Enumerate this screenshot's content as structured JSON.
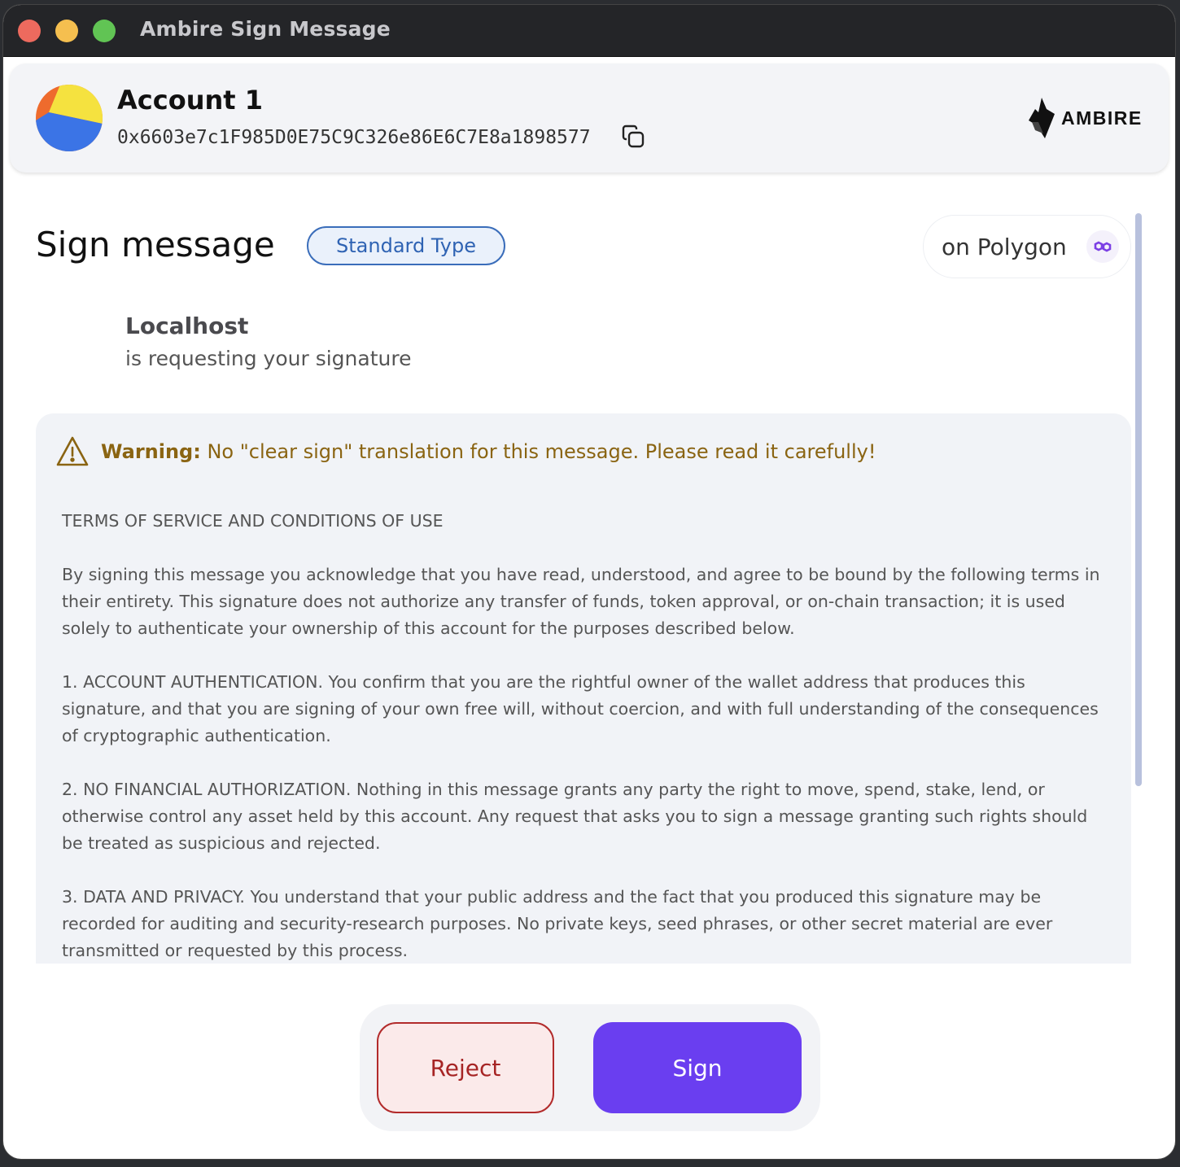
{
  "window": {
    "title": "Ambire Sign Message"
  },
  "account": {
    "name": "Account 1",
    "address": "0x6603e7c1F985D0E75C9C326e86E6C7E8a1898577"
  },
  "brand": {
    "name": "AMBIRE"
  },
  "page": {
    "title": "Sign message",
    "type_badge": "Standard Type",
    "network": "on Polygon"
  },
  "request": {
    "origin": "Localhost",
    "text": "is requesting your signature"
  },
  "warning": {
    "label": "Warning:",
    "text": " No \"clear sign\" translation for this message. Please read it carefully!"
  },
  "message": {
    "paragraphs": [
      "TERMS OF SERVICE AND CONDITIONS OF USE",
      "By signing this message you acknowledge that you have read, understood, and agree to be bound by the following terms in their entirety. This signature does not authorize any transfer of funds, token approval, or on-chain transaction; it is used solely to authenticate your ownership of this account for the purposes described below.",
      "1. ACCOUNT AUTHENTICATION. You confirm that you are the rightful owner of the wallet address that produces this signature, and that you are signing of your own free will, without coercion, and with full understanding of the consequences of cryptographic authentication.",
      "2. NO FINANCIAL AUTHORIZATION. Nothing in this message grants any party the right to move, spend, stake, lend, or otherwise control any asset held by this account. Any request that asks you to sign a message granting such rights should be treated as suspicious and rejected.",
      "3. DATA AND PRIVACY. You understand that your public address and the fact that you produced this signature may be recorded for auditing and security-research purposes. No private keys, seed phrases, or other secret material are ever transmitted or requested by this process."
    ]
  },
  "actions": {
    "reject": "Reject",
    "sign": "Sign"
  },
  "colors": {
    "accent": "#6a3ef0",
    "reject": "#b22b2b",
    "warning": "#8a6412",
    "badge": "#3a6dba"
  },
  "icons": {
    "copy": "copy-icon",
    "warning": "warning-triangle-icon",
    "network": "polygon-icon",
    "logo": "ambire-logo-icon"
  }
}
